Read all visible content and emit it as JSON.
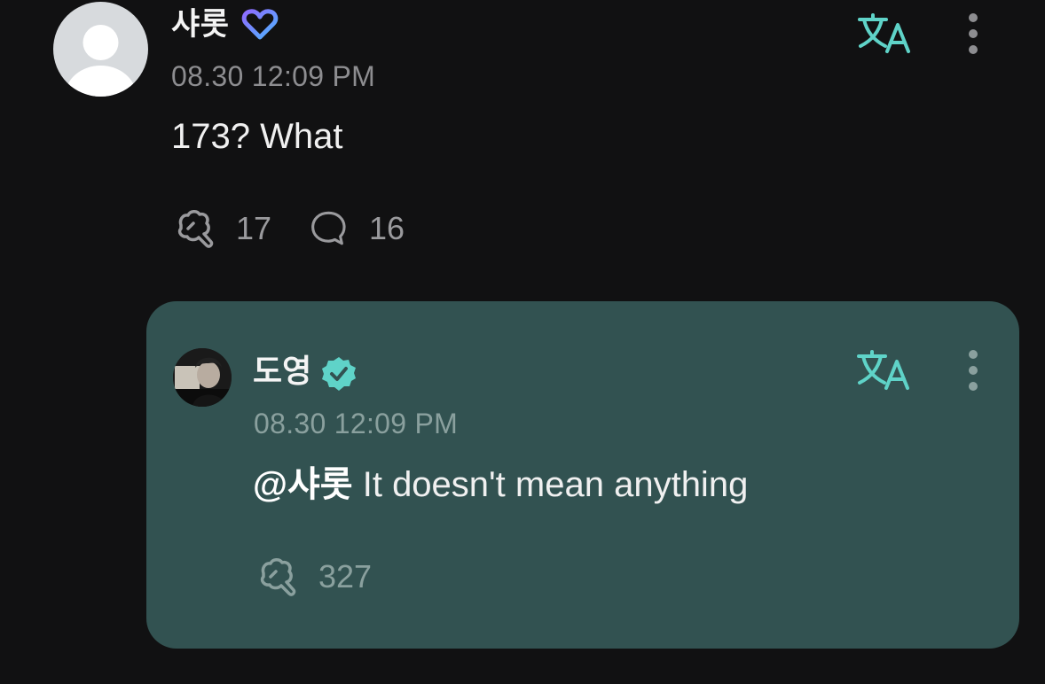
{
  "parent_post": {
    "author_name": "샤롯",
    "author_badge": "heart-badge-icon",
    "timestamp": "08.30 12:09 PM",
    "text": "173? What",
    "stats": {
      "reposts": "17",
      "comments": "16"
    }
  },
  "reply_post": {
    "author_name": "도영",
    "author_badge": "verified-badge-icon",
    "timestamp": "08.30 12:09 PM",
    "mention": "@샤롯",
    "text": " It doesn't mean anything",
    "stats": {
      "reposts": "327"
    }
  },
  "colors": {
    "background": "#111112",
    "reply_card": "#325251",
    "accent_teal": "#5fd3c8",
    "muted_text": "#8d8d90",
    "badge_gradient_start": "#8e6bff",
    "badge_gradient_end": "#4fb3ff"
  }
}
